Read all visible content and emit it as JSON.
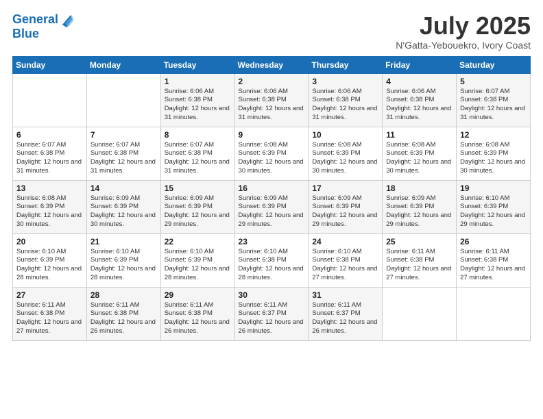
{
  "logo": {
    "line1": "General",
    "line2": "Blue"
  },
  "title": "July 2025",
  "location": "N'Gatta-Yebouekro, Ivory Coast",
  "header_days": [
    "Sunday",
    "Monday",
    "Tuesday",
    "Wednesday",
    "Thursday",
    "Friday",
    "Saturday"
  ],
  "weeks": [
    [
      {
        "day": "",
        "info": ""
      },
      {
        "day": "",
        "info": ""
      },
      {
        "day": "1",
        "info": "Sunrise: 6:06 AM\nSunset: 6:38 PM\nDaylight: 12 hours and 31 minutes."
      },
      {
        "day": "2",
        "info": "Sunrise: 6:06 AM\nSunset: 6:38 PM\nDaylight: 12 hours and 31 minutes."
      },
      {
        "day": "3",
        "info": "Sunrise: 6:06 AM\nSunset: 6:38 PM\nDaylight: 12 hours and 31 minutes."
      },
      {
        "day": "4",
        "info": "Sunrise: 6:06 AM\nSunset: 6:38 PM\nDaylight: 12 hours and 31 minutes."
      },
      {
        "day": "5",
        "info": "Sunrise: 6:07 AM\nSunset: 6:38 PM\nDaylight: 12 hours and 31 minutes."
      }
    ],
    [
      {
        "day": "6",
        "info": "Sunrise: 6:07 AM\nSunset: 6:38 PM\nDaylight: 12 hours and 31 minutes."
      },
      {
        "day": "7",
        "info": "Sunrise: 6:07 AM\nSunset: 6:38 PM\nDaylight: 12 hours and 31 minutes."
      },
      {
        "day": "8",
        "info": "Sunrise: 6:07 AM\nSunset: 6:38 PM\nDaylight: 12 hours and 31 minutes."
      },
      {
        "day": "9",
        "info": "Sunrise: 6:08 AM\nSunset: 6:39 PM\nDaylight: 12 hours and 30 minutes."
      },
      {
        "day": "10",
        "info": "Sunrise: 6:08 AM\nSunset: 6:39 PM\nDaylight: 12 hours and 30 minutes."
      },
      {
        "day": "11",
        "info": "Sunrise: 6:08 AM\nSunset: 6:39 PM\nDaylight: 12 hours and 30 minutes."
      },
      {
        "day": "12",
        "info": "Sunrise: 6:08 AM\nSunset: 6:39 PM\nDaylight: 12 hours and 30 minutes."
      }
    ],
    [
      {
        "day": "13",
        "info": "Sunrise: 6:08 AM\nSunset: 6:39 PM\nDaylight: 12 hours and 30 minutes."
      },
      {
        "day": "14",
        "info": "Sunrise: 6:09 AM\nSunset: 6:39 PM\nDaylight: 12 hours and 30 minutes."
      },
      {
        "day": "15",
        "info": "Sunrise: 6:09 AM\nSunset: 6:39 PM\nDaylight: 12 hours and 29 minutes."
      },
      {
        "day": "16",
        "info": "Sunrise: 6:09 AM\nSunset: 6:39 PM\nDaylight: 12 hours and 29 minutes."
      },
      {
        "day": "17",
        "info": "Sunrise: 6:09 AM\nSunset: 6:39 PM\nDaylight: 12 hours and 29 minutes."
      },
      {
        "day": "18",
        "info": "Sunrise: 6:09 AM\nSunset: 6:39 PM\nDaylight: 12 hours and 29 minutes."
      },
      {
        "day": "19",
        "info": "Sunrise: 6:10 AM\nSunset: 6:39 PM\nDaylight: 12 hours and 29 minutes."
      }
    ],
    [
      {
        "day": "20",
        "info": "Sunrise: 6:10 AM\nSunset: 6:39 PM\nDaylight: 12 hours and 28 minutes."
      },
      {
        "day": "21",
        "info": "Sunrise: 6:10 AM\nSunset: 6:39 PM\nDaylight: 12 hours and 28 minutes."
      },
      {
        "day": "22",
        "info": "Sunrise: 6:10 AM\nSunset: 6:39 PM\nDaylight: 12 hours and 28 minutes."
      },
      {
        "day": "23",
        "info": "Sunrise: 6:10 AM\nSunset: 6:38 PM\nDaylight: 12 hours and 28 minutes."
      },
      {
        "day": "24",
        "info": "Sunrise: 6:10 AM\nSunset: 6:38 PM\nDaylight: 12 hours and 27 minutes."
      },
      {
        "day": "25",
        "info": "Sunrise: 6:11 AM\nSunset: 6:38 PM\nDaylight: 12 hours and 27 minutes."
      },
      {
        "day": "26",
        "info": "Sunrise: 6:11 AM\nSunset: 6:38 PM\nDaylight: 12 hours and 27 minutes."
      }
    ],
    [
      {
        "day": "27",
        "info": "Sunrise: 6:11 AM\nSunset: 6:38 PM\nDaylight: 12 hours and 27 minutes."
      },
      {
        "day": "28",
        "info": "Sunrise: 6:11 AM\nSunset: 6:38 PM\nDaylight: 12 hours and 26 minutes."
      },
      {
        "day": "29",
        "info": "Sunrise: 6:11 AM\nSunset: 6:38 PM\nDaylight: 12 hours and 26 minutes."
      },
      {
        "day": "30",
        "info": "Sunrise: 6:11 AM\nSunset: 6:37 PM\nDaylight: 12 hours and 26 minutes."
      },
      {
        "day": "31",
        "info": "Sunrise: 6:11 AM\nSunset: 6:37 PM\nDaylight: 12 hours and 26 minutes."
      },
      {
        "day": "",
        "info": ""
      },
      {
        "day": "",
        "info": ""
      }
    ]
  ]
}
